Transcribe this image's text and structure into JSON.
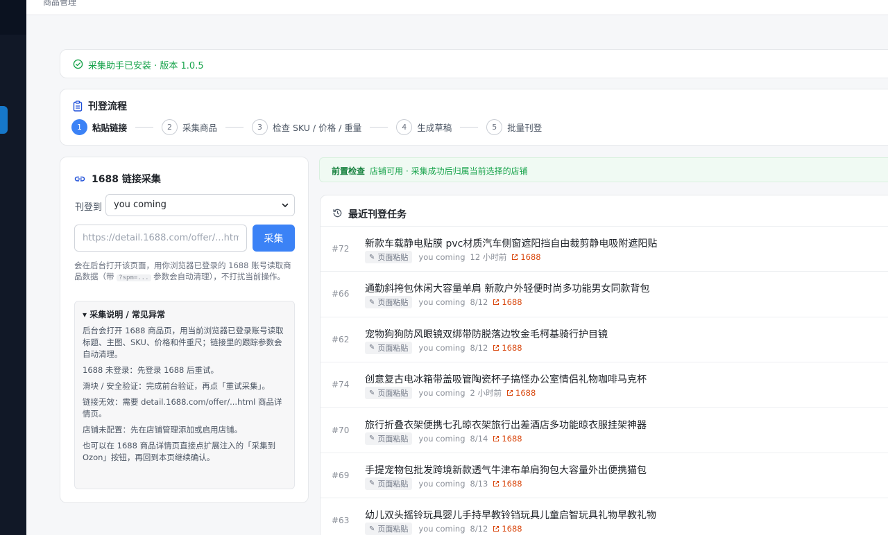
{
  "topbar": {
    "breadcrumb": "商品管理"
  },
  "installed": {
    "text": "采集助手已安装 · 版本 1.0.5"
  },
  "flow": {
    "title": "刊登流程",
    "steps": [
      {
        "num": "1",
        "label": "粘贴链接"
      },
      {
        "num": "2",
        "label": "采集商品"
      },
      {
        "num": "3",
        "label": "检查 SKU / 价格 / 重量"
      },
      {
        "num": "4",
        "label": "生成草稿"
      },
      {
        "num": "5",
        "label": "批量刊登"
      }
    ],
    "active_step": 1
  },
  "collect": {
    "title": "1688 链接采集",
    "store_label": "刊登到",
    "store_value": "you coming",
    "url_placeholder": "https://detail.1688.com/offer/...html",
    "button": "采集",
    "hint_a": "会在后台打开该页面，用你浏览器已登录的 1688 账号读取商品数据（带",
    "hint_code": "?spm=...",
    "hint_b": "参数会自动清理），不打扰当前操作。",
    "faq_title": "▾ 采集说明 / 常见异常",
    "faq": [
      "后台会打开 1688 商品页，用当前浏览器已登录账号读取标题、主图、SKU、价格和件重尺；链接里的跟踪参数会自动清理。",
      "1688 未登录：先登录 1688 后重试。",
      "滑块 / 安全验证：完成前台验证，再点「重试采集」。",
      "链接无效：需要 detail.1688.com/offer/...html 商品详情页。",
      "店铺未配置：先在店铺管理添加或启用店铺。",
      "也可以在 1688 商品详情页直接点扩展注入的「采集到 Ozon」按钮，再回到本页继续确认。"
    ]
  },
  "precheck": {
    "label": "前置检查",
    "status": "店铺可用",
    "note": "· 采集成功后归属当前选择的店铺"
  },
  "tasks": {
    "title": "最近刊登任务",
    "rows": [
      {
        "id": "#72",
        "name": "新款车载静电贴膜 pvc材质汽车侧窗遮阳挡自由裁剪静电吸附遮阳贴",
        "tag": "页面粘贴",
        "user": "you coming",
        "time": "12 小时前",
        "link": "1688"
      },
      {
        "id": "#66",
        "name": "通勤斜挎包休闲大容量单肩 新款户外轻便时尚多功能男女同款背包",
        "tag": "页面粘贴",
        "user": "you coming",
        "time": "8/12",
        "link": "1688"
      },
      {
        "id": "#62",
        "name": "宠物狗狗防风眼镜双绑带防脱落边牧金毛柯基骑行护目镜",
        "tag": "页面粘贴",
        "user": "you coming",
        "time": "8/12",
        "link": "1688"
      },
      {
        "id": "#74",
        "name": "创意复古电冰箱带盖吸管陶瓷杯子搞怪办公室情侣礼物咖啡马克杯",
        "tag": "页面粘贴",
        "user": "you coming",
        "time": "2 小时前",
        "link": "1688"
      },
      {
        "id": "#70",
        "name": "旅行折叠衣架便携七孔晾衣架旅行出差酒店多功能晾衣服挂架神器",
        "tag": "页面粘贴",
        "user": "you coming",
        "time": "8/14",
        "link": "1688"
      },
      {
        "id": "#69",
        "name": "手提宠物包批发跨境新款透气牛津布单肩狗包大容量外出便携猫包",
        "tag": "页面粘贴",
        "user": "you coming",
        "time": "8/13",
        "link": "1688"
      },
      {
        "id": "#63",
        "name": "幼儿双头摇铃玩具婴儿手持早教铃铛玩具儿童启智玩具礼物早教礼物",
        "tag": "页面粘贴",
        "user": "you coming",
        "time": "8/12",
        "link": "1688"
      }
    ]
  }
}
